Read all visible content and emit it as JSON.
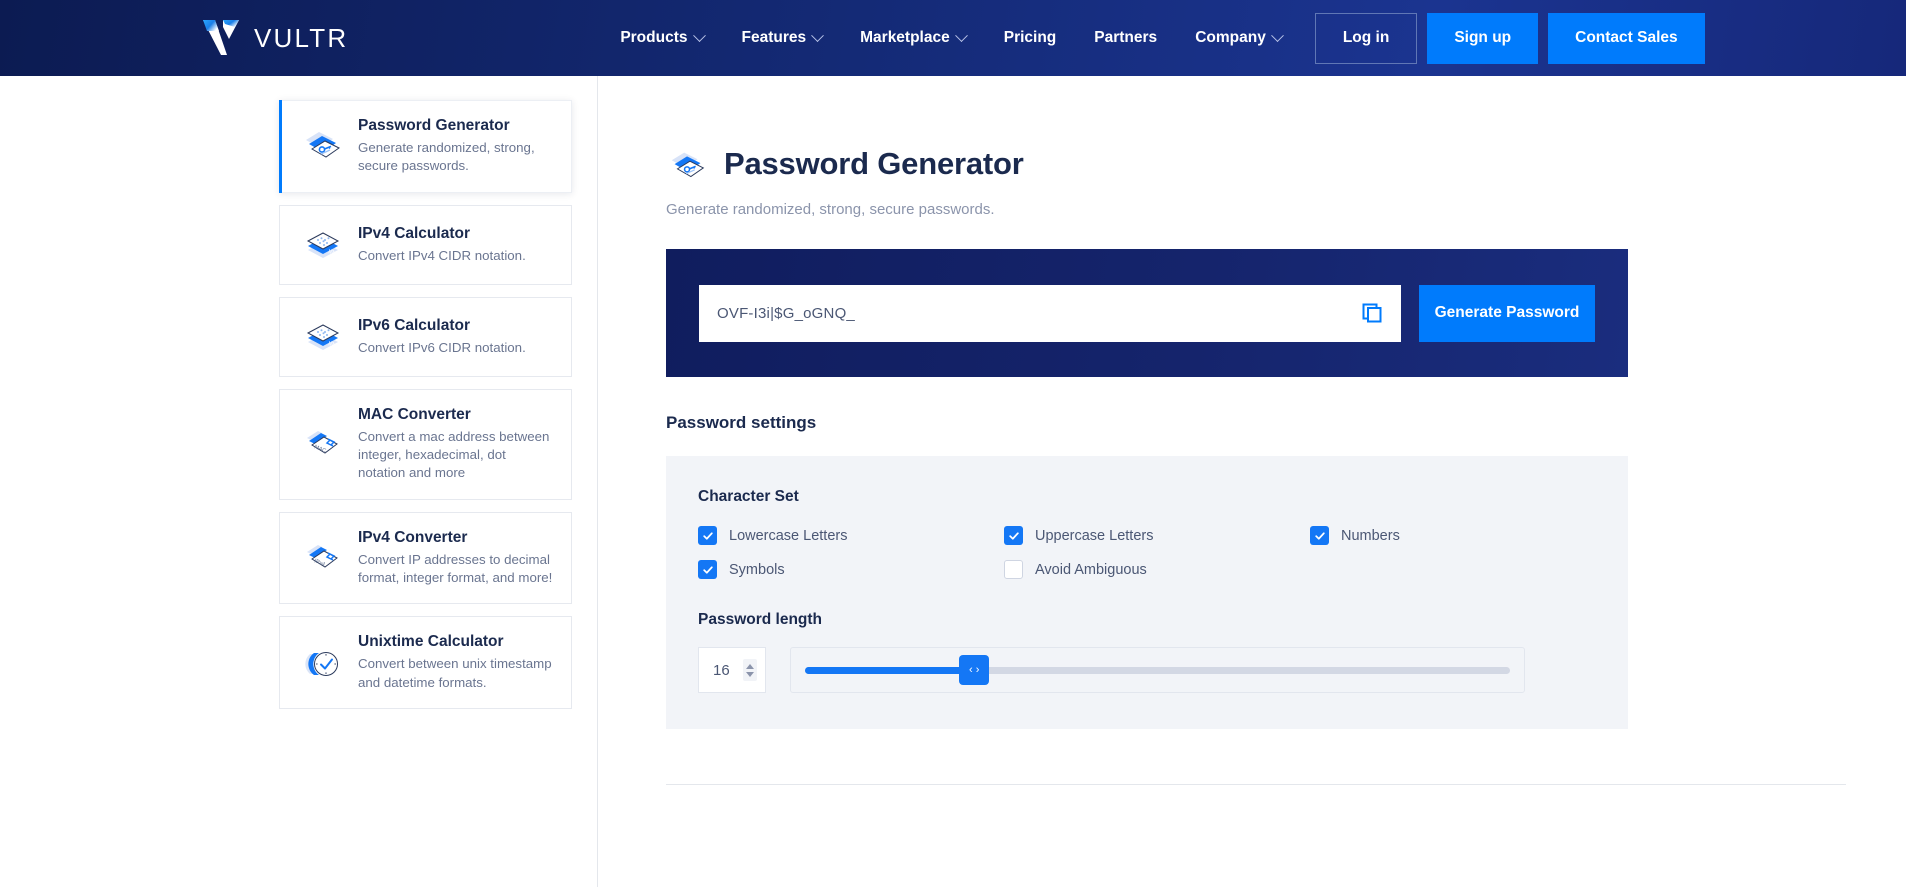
{
  "header": {
    "brand": "VULTR",
    "nav": [
      {
        "label": "Products",
        "has_caret": true
      },
      {
        "label": "Features",
        "has_caret": true
      },
      {
        "label": "Marketplace",
        "has_caret": true
      },
      {
        "label": "Pricing",
        "has_caret": false
      },
      {
        "label": "Partners",
        "has_caret": false
      },
      {
        "label": "Company",
        "has_caret": true
      }
    ],
    "login_label": "Log in",
    "signup_label": "Sign up",
    "contact_label": "Contact Sales",
    "bg_color": "#142a76",
    "accent_color": "#007bfc"
  },
  "sidebar": {
    "items": [
      {
        "title": "Password Generator",
        "desc": "Generate randomized, strong, secure passwords.",
        "icon": "password-card-icon",
        "active": true
      },
      {
        "title": "IPv4 Calculator",
        "desc": "Convert IPv4 CIDR notation.",
        "icon": "ipv4-calculator-icon",
        "active": false
      },
      {
        "title": "IPv6 Calculator",
        "desc": "Convert IPv6 CIDR notation.",
        "icon": "ipv6-calculator-icon",
        "active": false
      },
      {
        "title": "MAC Converter",
        "desc": "Convert a mac address between integer, hexadecimal, dot notation and more",
        "icon": "mac-converter-icon",
        "active": false
      },
      {
        "title": "IPv4 Converter",
        "desc": "Convert IP addresses to decimal format, integer format, and more!",
        "icon": "ipv4-converter-icon",
        "active": false
      },
      {
        "title": "Unixtime Calculator",
        "desc": "Convert between unix timestamp and datetime formats.",
        "icon": "unixtime-calculator-icon",
        "active": false
      }
    ]
  },
  "main": {
    "title": "Password Generator",
    "subtitle": "Generate randomized, strong, secure passwords.",
    "generator": {
      "password_value": "OVF-I3i|$G_oGNQ_",
      "copy_icon": "copy-icon",
      "generate_label": "Generate Password",
      "panel_color": "#15246c",
      "button_color": "#007bfc"
    },
    "settings": {
      "heading": "Password settings",
      "character_set_label": "Character Set",
      "options": [
        {
          "label": "Lowercase Letters",
          "checked": true
        },
        {
          "label": "Uppercase Letters",
          "checked": true
        },
        {
          "label": "Numbers",
          "checked": true
        },
        {
          "label": "Symbols",
          "checked": true
        },
        {
          "label": "Avoid Ambiguous",
          "checked": false
        }
      ],
      "length_label": "Password length",
      "length_value": "16",
      "slider": {
        "value": 16,
        "min": 1,
        "max": 64,
        "fill_percent": 24,
        "thumb_percent": 24,
        "fill_color": "#1477f5",
        "track_color": "#d3d8e4",
        "thumb_glyph_left": "‹",
        "thumb_glyph_right": "›"
      }
    }
  }
}
